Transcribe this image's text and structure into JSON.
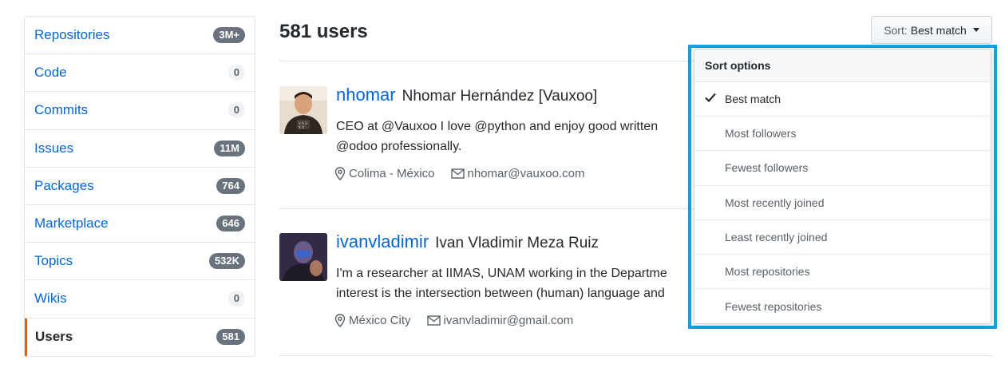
{
  "sidebar": {
    "items": [
      {
        "label": "Repositories",
        "count": "3M+",
        "style": "dark"
      },
      {
        "label": "Code",
        "count": "0",
        "style": "light"
      },
      {
        "label": "Commits",
        "count": "0",
        "style": "light"
      },
      {
        "label": "Issues",
        "count": "11M",
        "style": "dark"
      },
      {
        "label": "Packages",
        "count": "764",
        "style": "dark"
      },
      {
        "label": "Marketplace",
        "count": "646",
        "style": "dark"
      },
      {
        "label": "Topics",
        "count": "532K",
        "style": "dark"
      },
      {
        "label": "Wikis",
        "count": "0",
        "style": "light"
      },
      {
        "label": "Users",
        "count": "581",
        "style": "dark",
        "selected": true
      }
    ]
  },
  "results": {
    "title": "581 users"
  },
  "sort": {
    "prefix": "Sort:",
    "value": "Best match",
    "dropdown": {
      "header": "Sort options",
      "options": [
        {
          "label": "Best match",
          "selected": true
        },
        {
          "label": "Most followers"
        },
        {
          "label": "Fewest followers"
        },
        {
          "label": "Most recently joined"
        },
        {
          "label": "Least recently joined"
        },
        {
          "label": "Most repositories"
        },
        {
          "label": "Fewest repositories"
        }
      ]
    }
  },
  "users": [
    {
      "login": "nhomar",
      "name": "Nhomar Hernández [Vauxoo]",
      "bio_line1": "CEO at @Vauxoo I love @python and enjoy good written",
      "bio_line2": "@odoo professionally.",
      "location": "Colima - México",
      "email": "nhomar@vauxoo.com"
    },
    {
      "login": "ivanvladimir",
      "name": "Ivan Vladimir Meza Ruiz",
      "bio_line1": "I'm a researcher at IIMAS, UNAM working in the Departme",
      "bio_line2": "interest is the intersection between (human) language and",
      "location": "México City",
      "email": "ivanvladimir@gmail.com"
    }
  ],
  "colors": {
    "link": "#0366d6",
    "selected_accent": "#e36209",
    "highlight_border": "#1ba1e2"
  }
}
